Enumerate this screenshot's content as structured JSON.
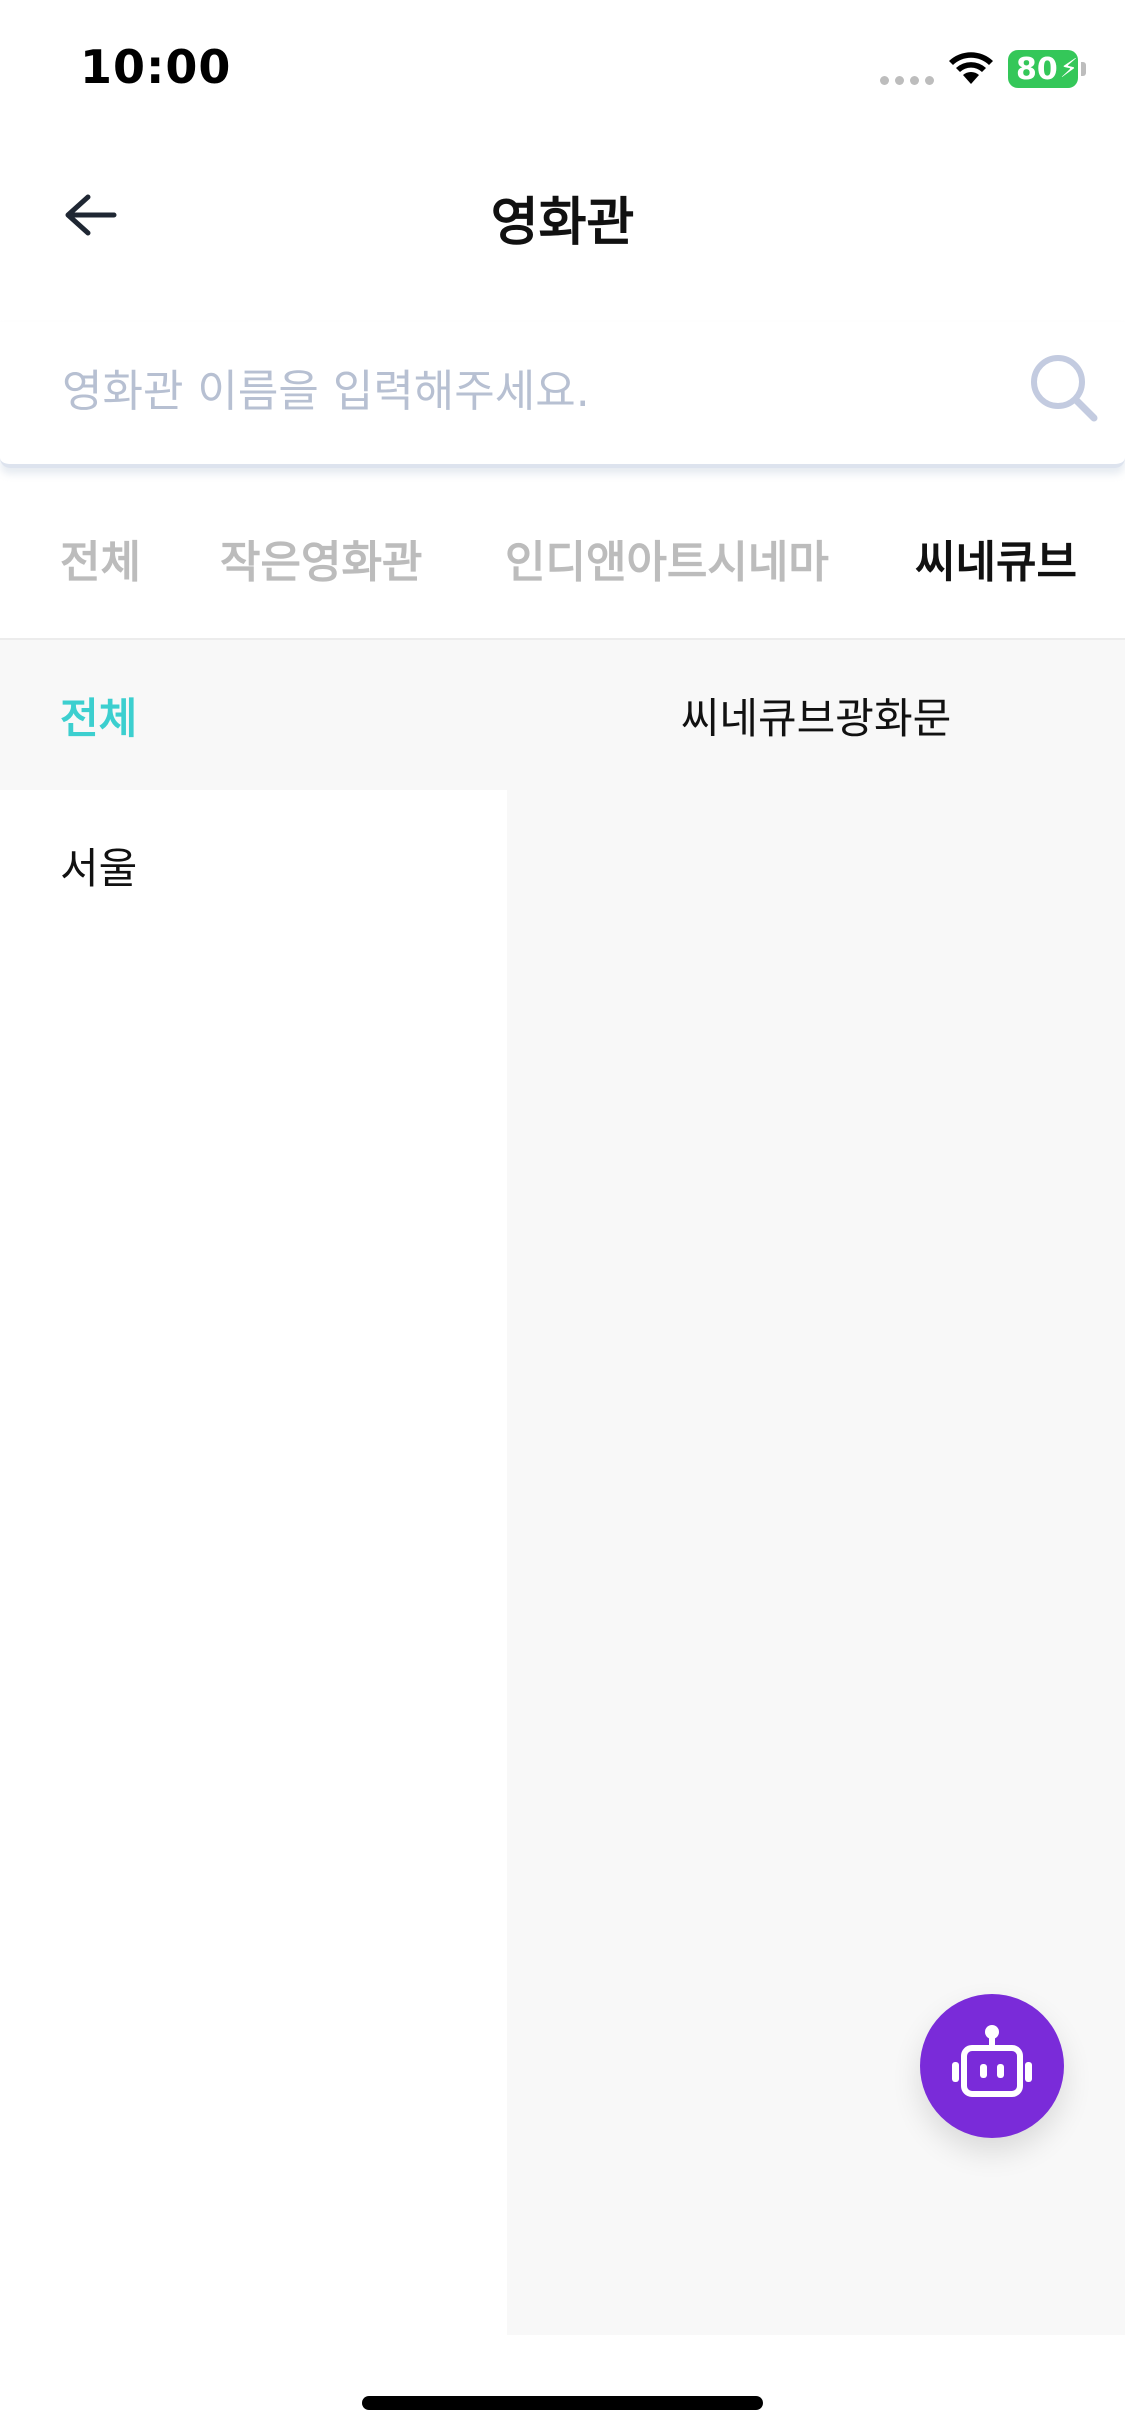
{
  "status_bar": {
    "time": "10:00",
    "battery": "80"
  },
  "header": {
    "title": "영화관"
  },
  "search": {
    "placeholder": "영화관 이름을 입력해주세요."
  },
  "tabs": [
    {
      "label": "전체",
      "active": false
    },
    {
      "label": "작은영화관",
      "active": false
    },
    {
      "label": "인디앤아트시네마",
      "active": false
    },
    {
      "label": "씨네큐브",
      "active": true
    }
  ],
  "regions": [
    {
      "label": "전체",
      "selected": true
    },
    {
      "label": "서울",
      "selected": false
    }
  ],
  "theaters": [
    {
      "label": "씨네큐브광화문"
    }
  ],
  "colors": {
    "accent": "#3ccfcf",
    "fab": "#7a2bd9",
    "battery": "#34c759",
    "placeholder": "#b7c0d2"
  },
  "icons": {
    "back": "arrow-left-icon",
    "search": "search-icon",
    "fab": "robot-icon"
  }
}
